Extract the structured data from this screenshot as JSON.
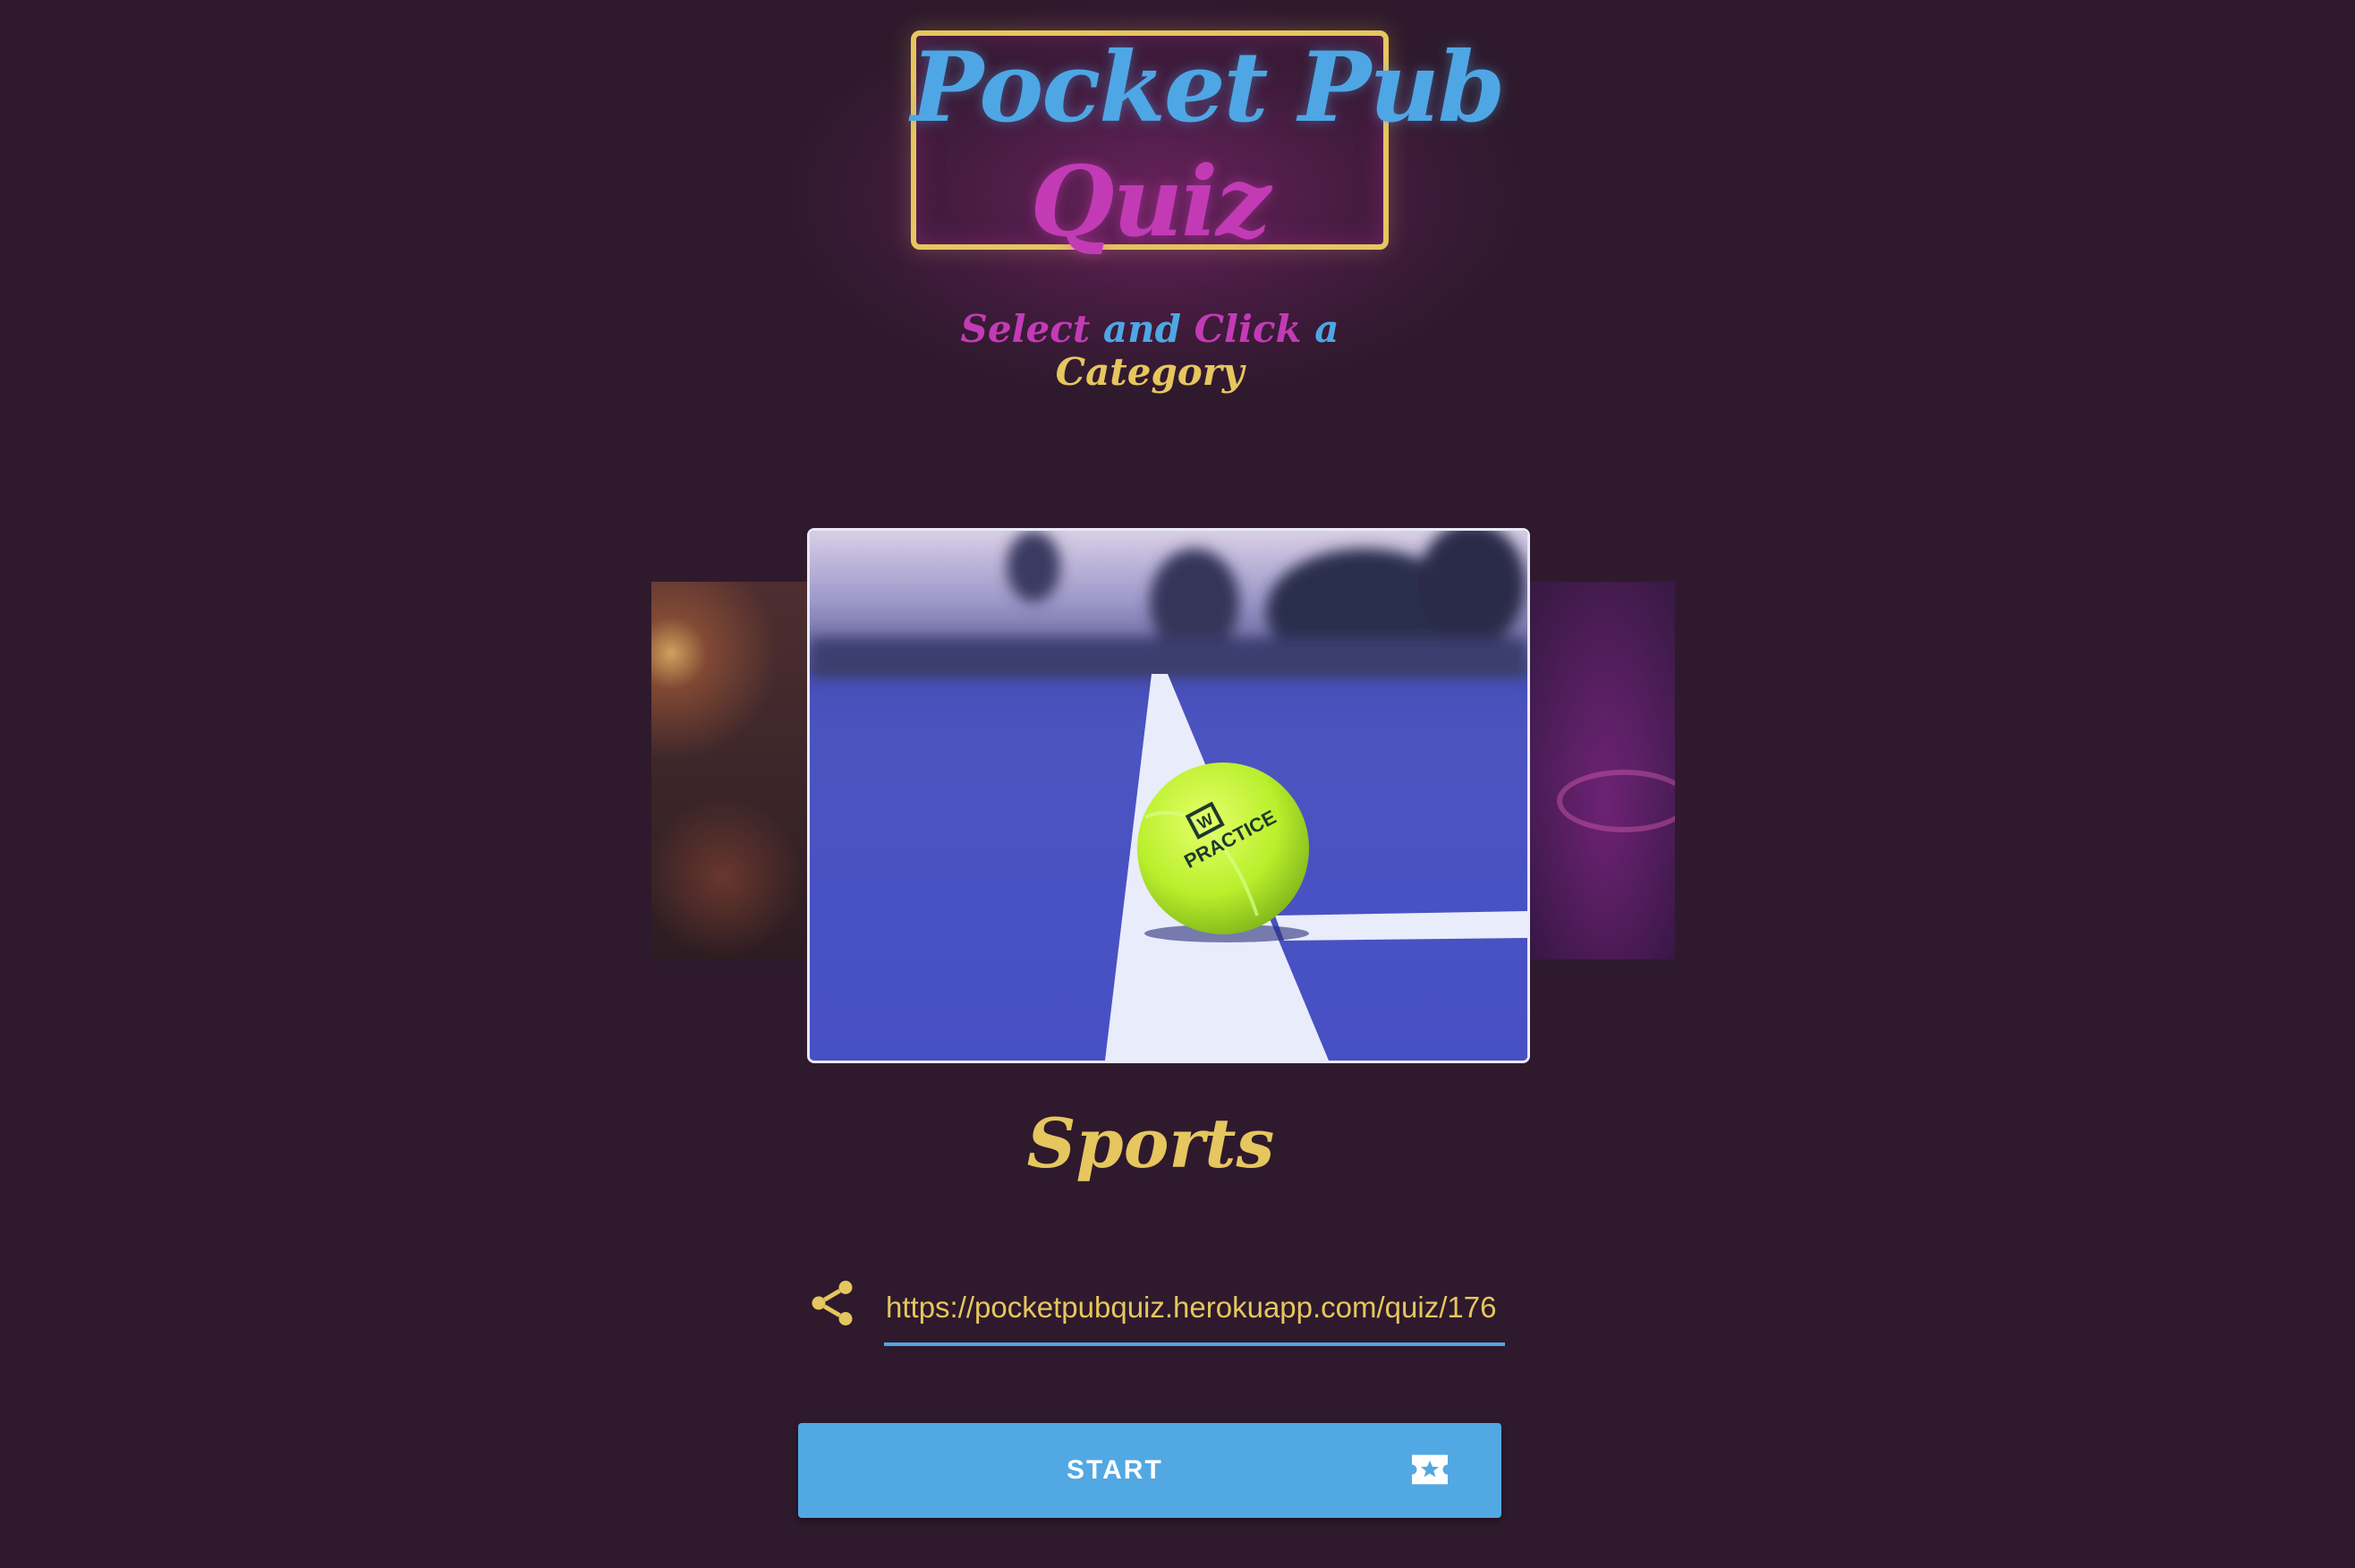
{
  "logo": {
    "line1": "Pocket Pub",
    "line2": "Quiz"
  },
  "instruction": {
    "word1": "Select",
    "word2": "and",
    "word3": "Click",
    "word4": "a",
    "word5": "Category"
  },
  "carousel": {
    "current_category": "Sports",
    "ball_brand": "W",
    "ball_text": "PRACTICE"
  },
  "share": {
    "icon": "share-icon",
    "url": "https://pocketpubquiz.herokuapp.com/quiz/176"
  },
  "start_button": {
    "label": "START",
    "icon": "ticket-star-icon"
  },
  "colors": {
    "background": "#2e1a2c",
    "accent_blue": "#4fa6e4",
    "accent_pink": "#c23bb5",
    "accent_yellow": "#e6c65e",
    "button_blue": "#52a8e3"
  }
}
